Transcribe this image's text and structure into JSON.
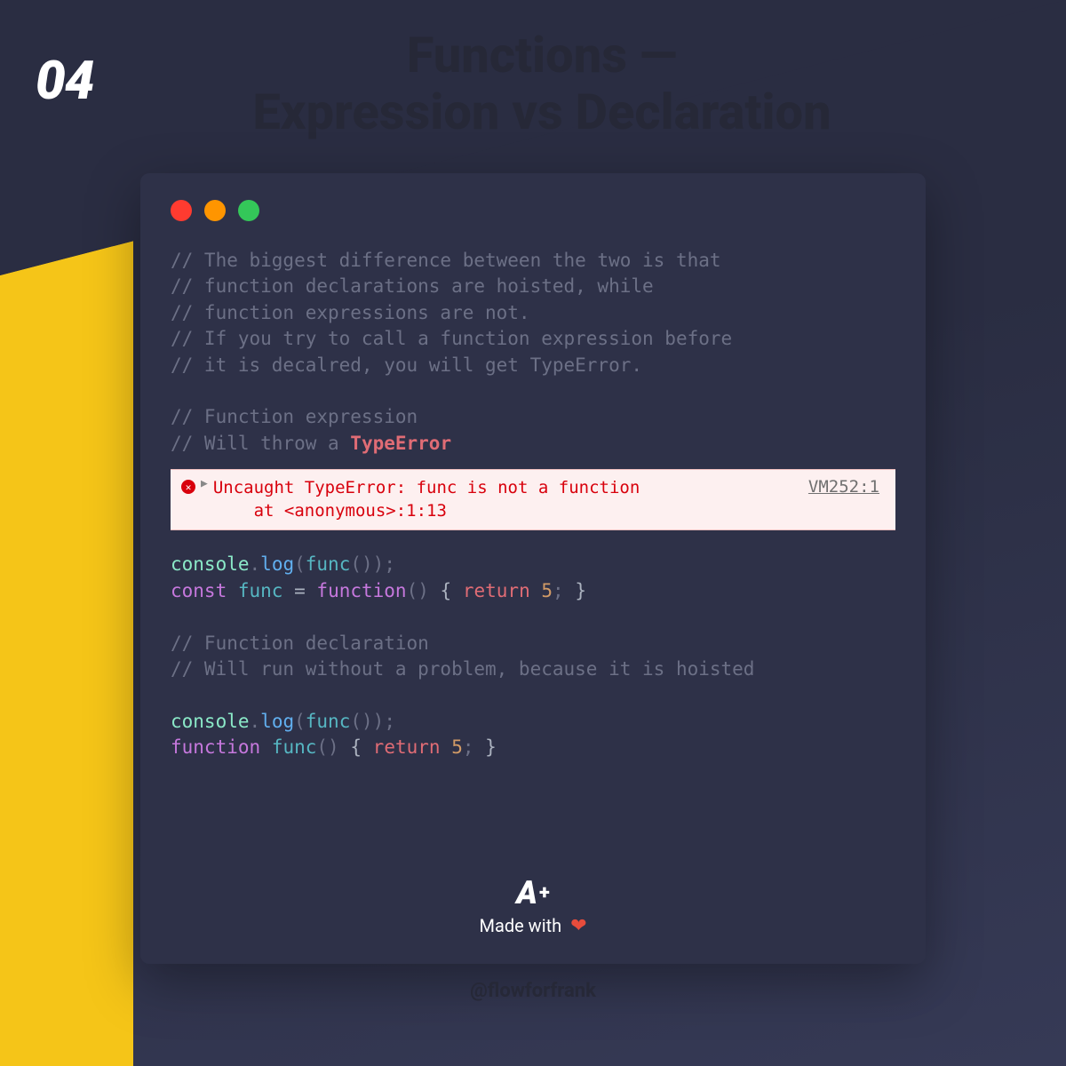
{
  "page_number": "04",
  "title_line1": "Functions —",
  "title_line2": "Expression vs Declaration",
  "code": {
    "comment1": "// The biggest difference between the two is that",
    "comment2": "// function declarations are hoisted, while",
    "comment3": "// function expressions are not.",
    "comment4": "// If you try to call a function expression before",
    "comment5": "// it is decalred, you will get TypeError.",
    "comment6": "// Function expression",
    "comment7a": "// Will throw a ",
    "comment7b": "TypeError",
    "comment8": "// Function declaration",
    "comment9": "// Will run without a problem, because it is hoisted",
    "console": "console",
    "log": "log",
    "func": "func",
    "const": "const",
    "function": "function",
    "return": "return",
    "five": "5"
  },
  "error": {
    "line1": "Uncaught TypeError: func is not a function",
    "line2": "    at <anonymous>:1:13",
    "source": "VM252:1"
  },
  "badge": {
    "a": "A",
    "plus": "+",
    "made_with": "Made with",
    "heart": "❤"
  },
  "handle": "@flowforfrank"
}
